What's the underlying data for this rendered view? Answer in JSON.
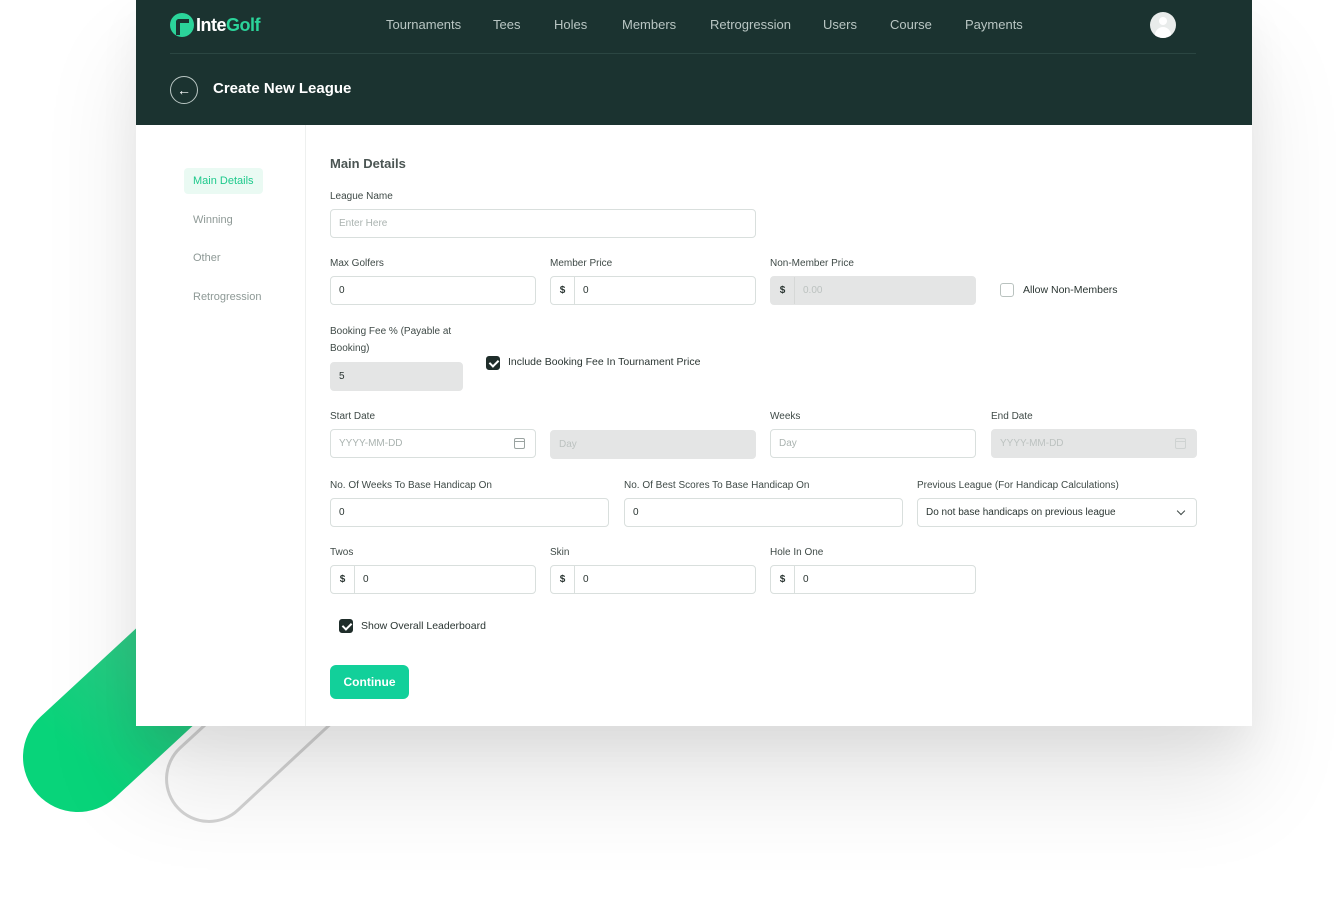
{
  "app": {
    "logo": {
      "part1": "Inte",
      "part2": "Golf"
    },
    "nav": [
      "Tournaments",
      "Tees",
      "Holes",
      "Members",
      "Retrogression",
      "Users",
      "Course",
      "Payments"
    ],
    "page_title": "Create New League",
    "back_icon": "arrow-left-icon"
  },
  "sidebar": {
    "items": [
      {
        "label": "Main Details",
        "active": true
      },
      {
        "label": "Winning",
        "active": false
      },
      {
        "label": "Other",
        "active": false
      },
      {
        "label": "Retrogression",
        "active": false
      }
    ]
  },
  "form": {
    "section_title": "Main Details",
    "league_name": {
      "label": "League Name",
      "placeholder": "Enter Here",
      "value": ""
    },
    "max_golfers": {
      "label": "Max Golfers",
      "value": "0"
    },
    "member_price": {
      "label": "Member Price",
      "currency": "$",
      "value": "0"
    },
    "non_member_price": {
      "label": "Non-Member Price",
      "currency": "$",
      "placeholder": "0.00",
      "disabled": true
    },
    "allow_non_members": {
      "label": "Allow Non-Members",
      "checked": false
    },
    "booking_fee": {
      "label": "Booking Fee % (Payable at Booking)",
      "value": "5",
      "disabled": true
    },
    "include_booking_fee": {
      "label": "Include Booking Fee In Tournament Price",
      "checked": true
    },
    "start_date": {
      "label": "Start Date",
      "placeholder": "YYYY-MM-DD"
    },
    "day": {
      "placeholder": "Day",
      "disabled": true
    },
    "weeks": {
      "label": "Weeks",
      "placeholder": "Day"
    },
    "end_date": {
      "label": "End Date",
      "placeholder": "YYYY-MM-DD",
      "disabled": true
    },
    "weeks_handicap": {
      "label": "No. Of Weeks To Base Handicap On",
      "value": "0"
    },
    "best_scores": {
      "label": "No. Of Best Scores To Base Handicap On",
      "value": "0"
    },
    "previous_league": {
      "label": "Previous League (For Handicap Calculations)",
      "selected": "Do not base handicaps on previous league"
    },
    "twos": {
      "label": "Twos",
      "currency": "$",
      "value": "0"
    },
    "skin": {
      "label": "Skin",
      "currency": "$",
      "value": "0"
    },
    "hole_in_one": {
      "label": "Hole In One",
      "currency": "$",
      "value": "0"
    },
    "show_leaderboard": {
      "label": "Show Overall Leaderboard",
      "checked": true
    },
    "continue_label": "Continue"
  },
  "colors": {
    "header_bg": "#1b3330",
    "accent": "#12d09a",
    "active_sidebar_bg": "#eafaf3"
  }
}
